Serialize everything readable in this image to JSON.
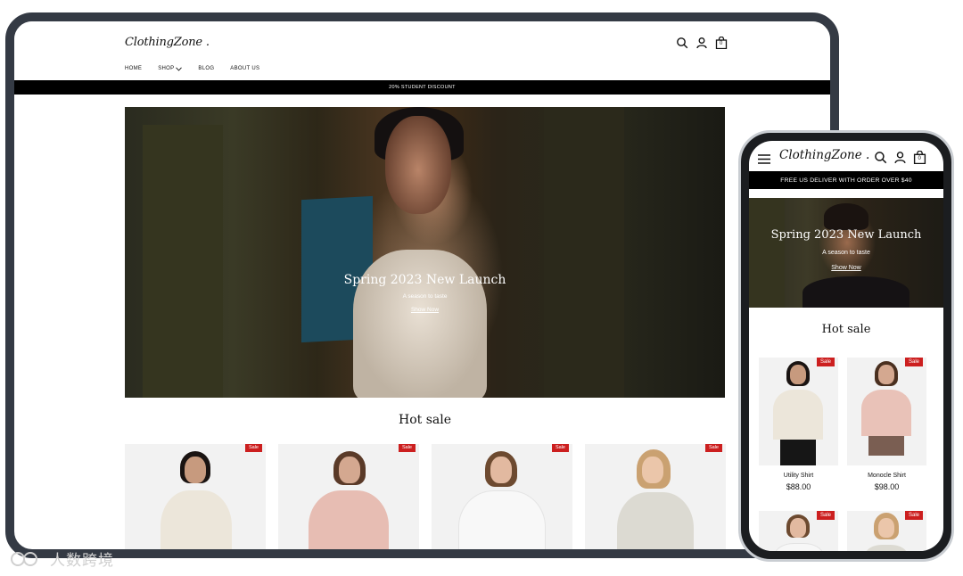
{
  "brand": {
    "logo": "ClothingZone ."
  },
  "desktop": {
    "nav": [
      {
        "label": "HOME"
      },
      {
        "label": "SHOP"
      },
      {
        "label": "BLOG"
      },
      {
        "label": "ABOUT US"
      }
    ],
    "cart_count": "0",
    "banner": "20% STUDENT DISCOUNT",
    "hero": {
      "title": "Spring 2023 New Launch",
      "subtitle": "A season to taste",
      "link": "Show Now"
    },
    "section_title": "Hot sale",
    "products": [
      {
        "badge": "Sale"
      },
      {
        "badge": "Sale"
      },
      {
        "badge": "Sale"
      },
      {
        "badge": "Sale"
      }
    ]
  },
  "mobile": {
    "cart_count": "0",
    "banner": "FREE US DELIVER WITH ORDER OVER $40",
    "hero": {
      "title": "Spring 2023 New Launch",
      "subtitle": "A season to taste",
      "link": "Show Now"
    },
    "section_title": "Hot sale",
    "products": [
      {
        "badge": "Sale",
        "name": "Utility Shirt",
        "price": "$88.00"
      },
      {
        "badge": "Sale",
        "name": "Monocle Shirt",
        "price": "$98.00"
      }
    ],
    "products_row2": [
      {
        "badge": "Sale"
      },
      {
        "badge": "Sale"
      }
    ]
  },
  "watermark": "人数跨境"
}
